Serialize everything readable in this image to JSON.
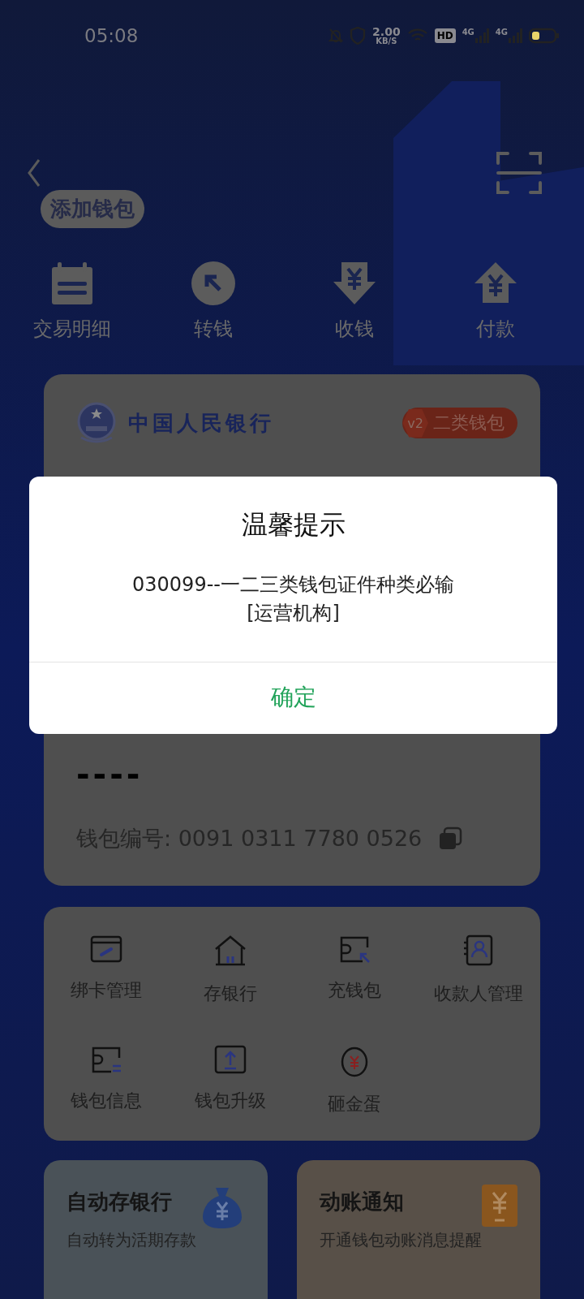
{
  "status_bar": {
    "time": "05:08",
    "speed": "2.00",
    "speed_unit": "KB/S",
    "hd": "HD",
    "sim_labels": [
      "4G",
      "4G"
    ]
  },
  "header": {
    "add_wallet_button": "添加钱包"
  },
  "quick_actions": [
    {
      "label": "交易明细",
      "kind": "calendar"
    },
    {
      "label": "转钱",
      "kind": "transfer"
    },
    {
      "label": "收钱",
      "kind": "receive"
    },
    {
      "label": "付款",
      "kind": "pay"
    }
  ],
  "wallet_card": {
    "issuer": "中国人民银行",
    "tier_badge": "v2",
    "tier_label": "二类钱包",
    "balance": "----",
    "number_label": "钱包编号:",
    "number": "0091 0311 7780 0526"
  },
  "services": [
    {
      "label": "绑卡管理",
      "kind": "card"
    },
    {
      "label": "存银行",
      "kind": "bank"
    },
    {
      "label": "充钱包",
      "kind": "topup"
    },
    {
      "label": "收款人管理",
      "kind": "contacts"
    },
    {
      "label": "钱包信息",
      "kind": "info"
    },
    {
      "label": "钱包升级",
      "kind": "upgrade"
    },
    {
      "label": "砸金蛋",
      "kind": "egg"
    }
  ],
  "promos": [
    {
      "title": "自动存银行",
      "subtitle": "自动转为活期存款",
      "kind": "savings"
    },
    {
      "title": "动账通知",
      "subtitle": "开通钱包动账消息提醒",
      "kind": "notice"
    }
  ],
  "dialog": {
    "title": "温馨提示",
    "message_lines": [
      "030099--一二三类钱包证件种类必输",
      "[运营机构]"
    ],
    "confirm": "确定"
  }
}
